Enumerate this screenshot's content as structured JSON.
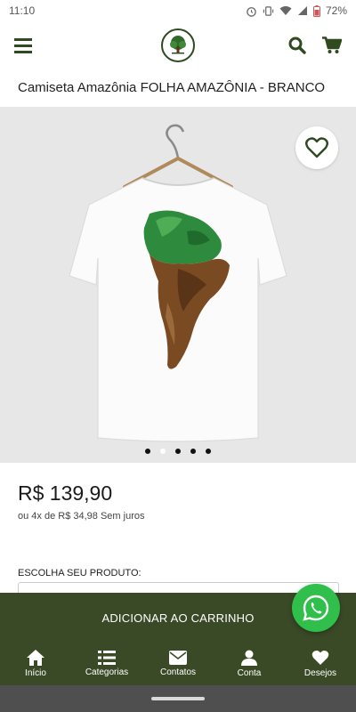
{
  "status_bar": {
    "time": "11:10",
    "battery": "72%"
  },
  "header": {
    "logo": "tree-logo"
  },
  "product": {
    "title": "Camiseta Amazônia FOLHA AMAZÔNIA - BRANCO",
    "price": "R$ 139,90",
    "installments": "ou 4x de R$ 34,98 Sem juros",
    "gallery_dots": 5,
    "active_dot": 1
  },
  "form": {
    "choose_label": "ESCOLHA SEU PRODUTO:"
  },
  "cart": {
    "add_label": "ADICIONAR AO CARRINHO"
  },
  "nav": {
    "items": [
      {
        "label": "Início",
        "icon": "home-icon"
      },
      {
        "label": "Categorias",
        "icon": "list-icon"
      },
      {
        "label": "Contatos",
        "icon": "envelope-icon"
      },
      {
        "label": "Conta",
        "icon": "user-icon"
      },
      {
        "label": "Desejos",
        "icon": "heart-icon"
      }
    ]
  },
  "colors": {
    "brand_green": "#3a4a27",
    "whatsapp": "#2fbf4a",
    "gallery_bg": "#e7e7e7"
  }
}
